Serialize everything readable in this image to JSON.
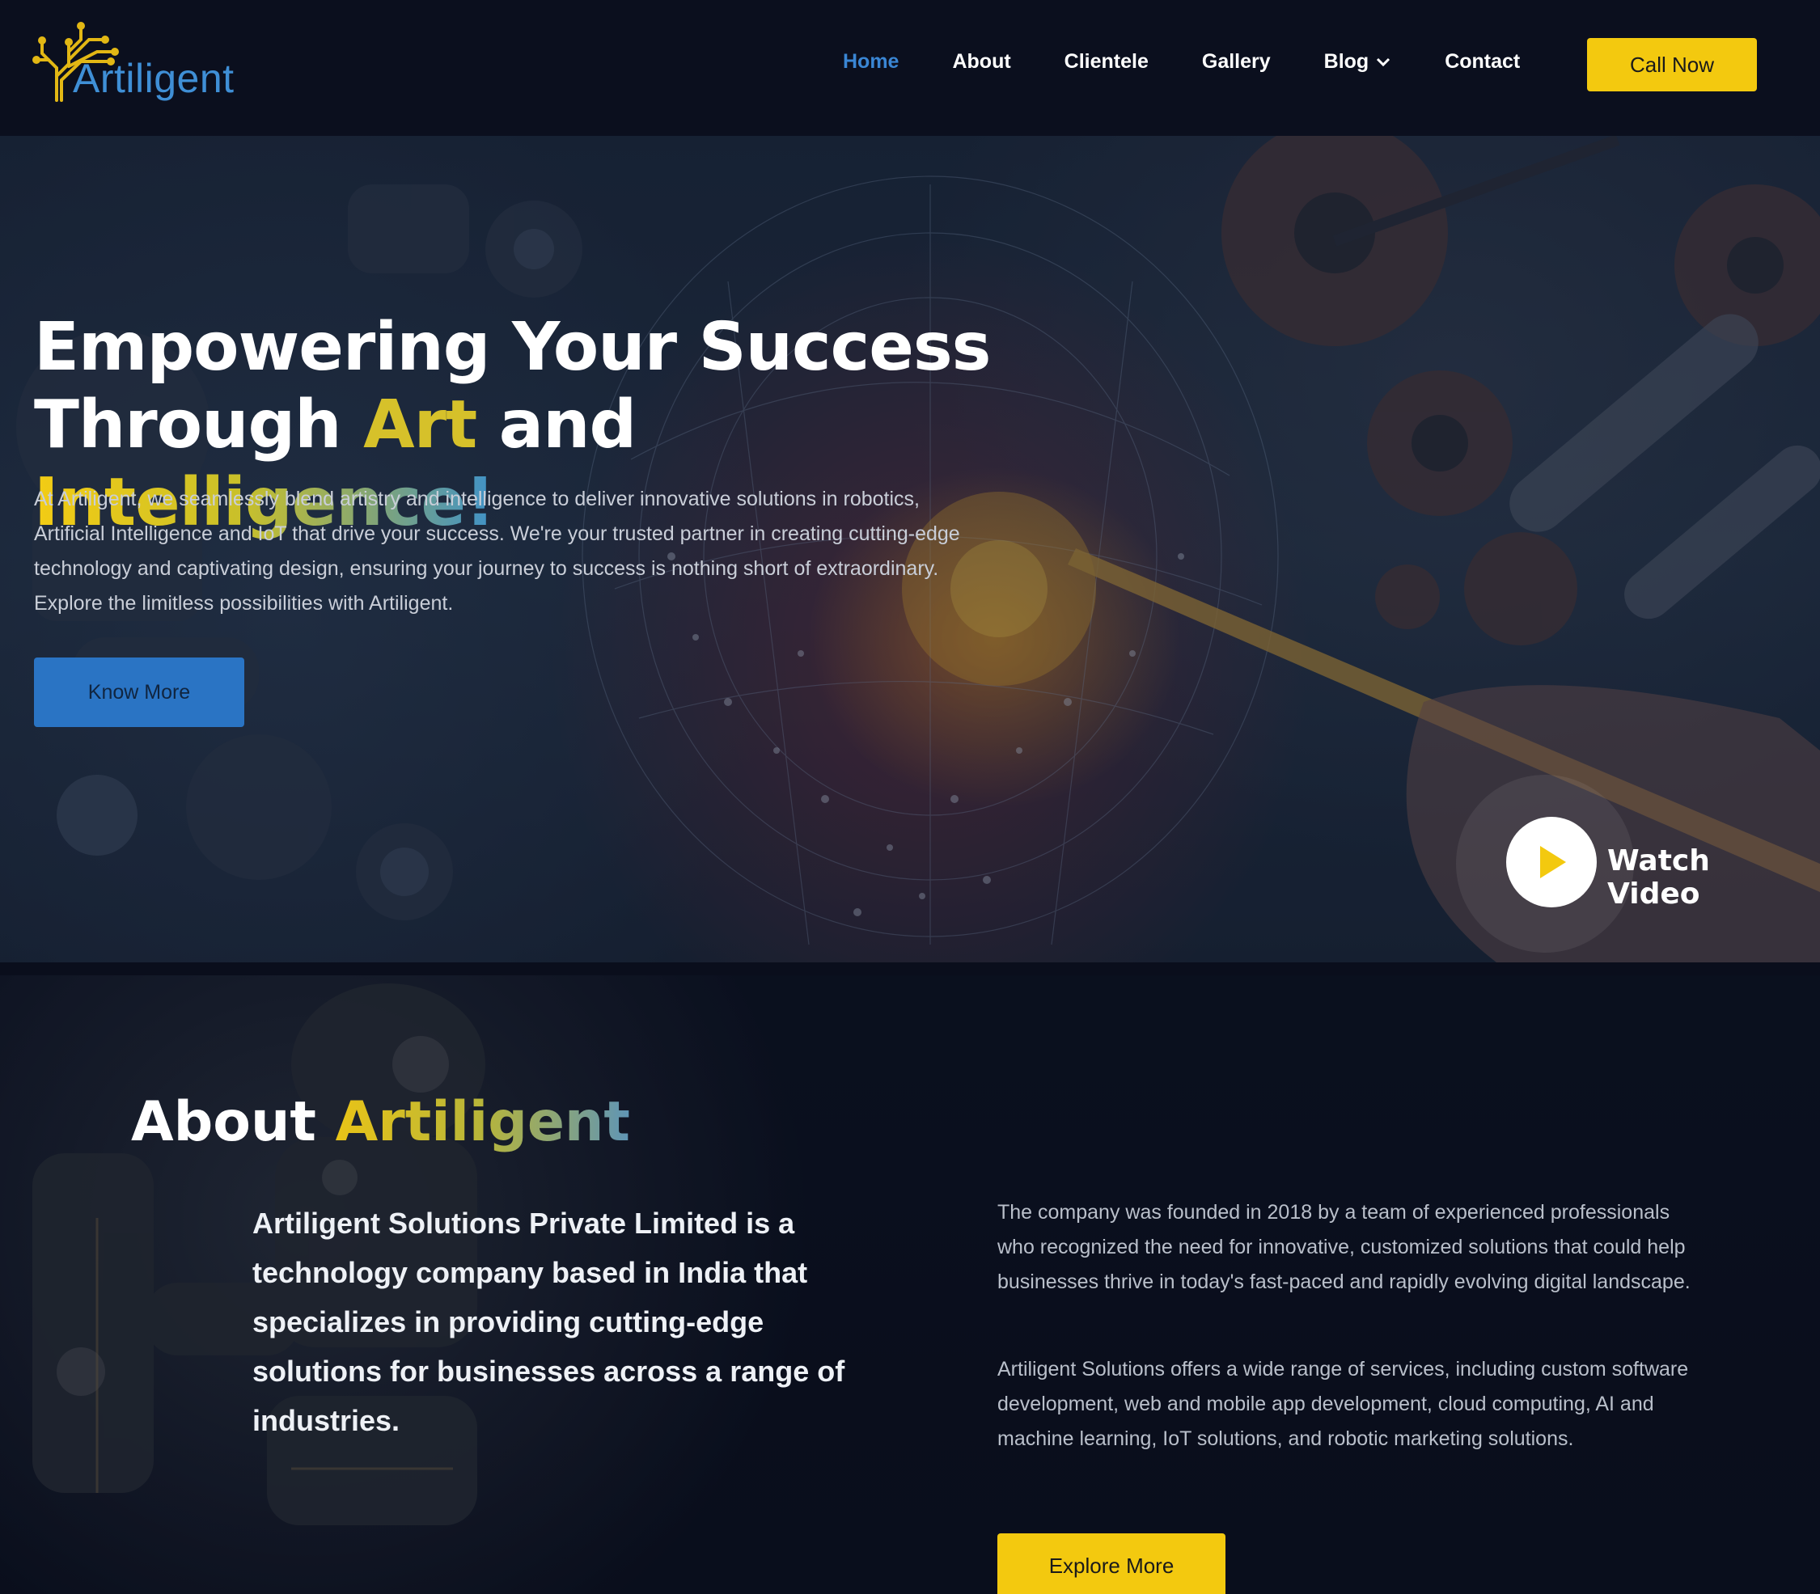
{
  "brand": {
    "logo_text": "Artiligent",
    "logo_icon": "circuit-tree-icon"
  },
  "nav": {
    "items": [
      {
        "label": "Home",
        "active": true
      },
      {
        "label": "About"
      },
      {
        "label": "Clientele"
      },
      {
        "label": "Gallery"
      },
      {
        "label": "Blog",
        "has_dropdown": true
      },
      {
        "label": "Contact"
      }
    ],
    "cta_label": "Call Now"
  },
  "hero": {
    "title_line1": "Empowering Your Success",
    "title_line2_a": "Through",
    "title_line2_art": "Art",
    "title_line2_b": "and",
    "title_line2_intel": "Intelligence!",
    "description": "At Artiligent, we seamlessly blend artistry and intelligence to deliver innovative solutions in robotics, Artificial Intelligence and IoT that drive your success. We're your trusted partner in creating cutting-edge technology and captivating design, ensuring your journey to success is nothing short of extraordinary. Explore the limitless possibilities with Artiligent.",
    "button_label": "Know More",
    "watch_label": "Watch Video"
  },
  "about": {
    "title_prefix": "About",
    "title_brand": "Artiligent",
    "lead": "Artiligent Solutions Private Limited is a technology company based in India that specializes in providing cutting-edge solutions for businesses across a range of industries.",
    "paragraph1": "The company was founded in 2018 by a team of experienced professionals who recognized the need for innovative, customized solutions that could help businesses thrive in today's fast-paced and rapidly evolving digital landscape.",
    "paragraph2": "Artiligent Solutions offers a wide range of services, including custom software development, web and mobile app development, cloud computing, AI and machine learning, IoT solutions, and robotic marketing solutions.",
    "button_label": "Explore More"
  },
  "colors": {
    "accent_yellow": "#f3c90f",
    "accent_blue": "#2a74c4",
    "nav_active": "#3a86d4",
    "background": "#0a0e1c"
  }
}
